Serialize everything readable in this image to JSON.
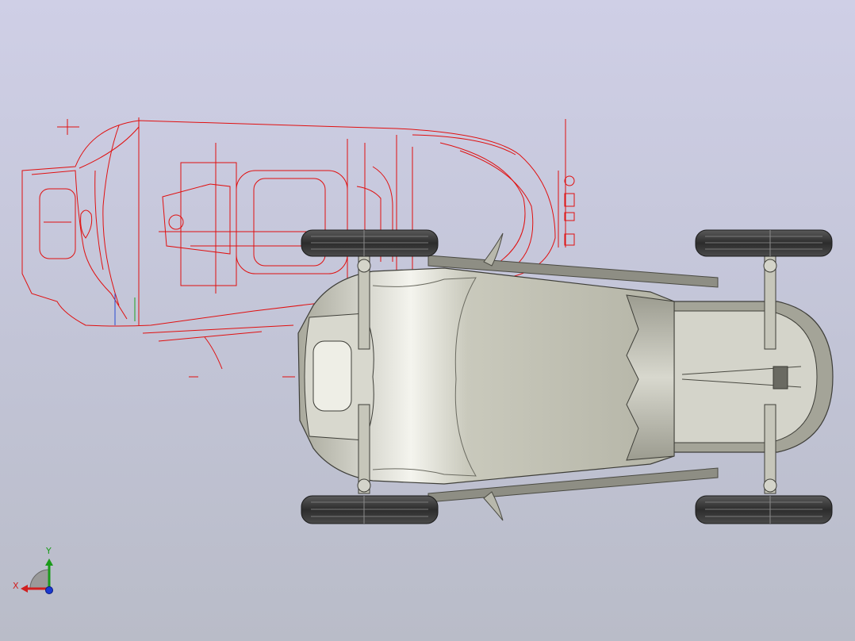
{
  "viewport": {
    "background_top": "#cfcfe6",
    "background_bottom": "#b9bcc8"
  },
  "sketch": {
    "color": "#e01010"
  },
  "model": {
    "body_color": "#c8c8bc",
    "tire_color": "#3a3a3a"
  },
  "triad": {
    "x_label": "X",
    "y_label": "Y",
    "x_color": "#d02020",
    "y_color": "#1a9a1a",
    "z_color": "#1a3ad0"
  }
}
